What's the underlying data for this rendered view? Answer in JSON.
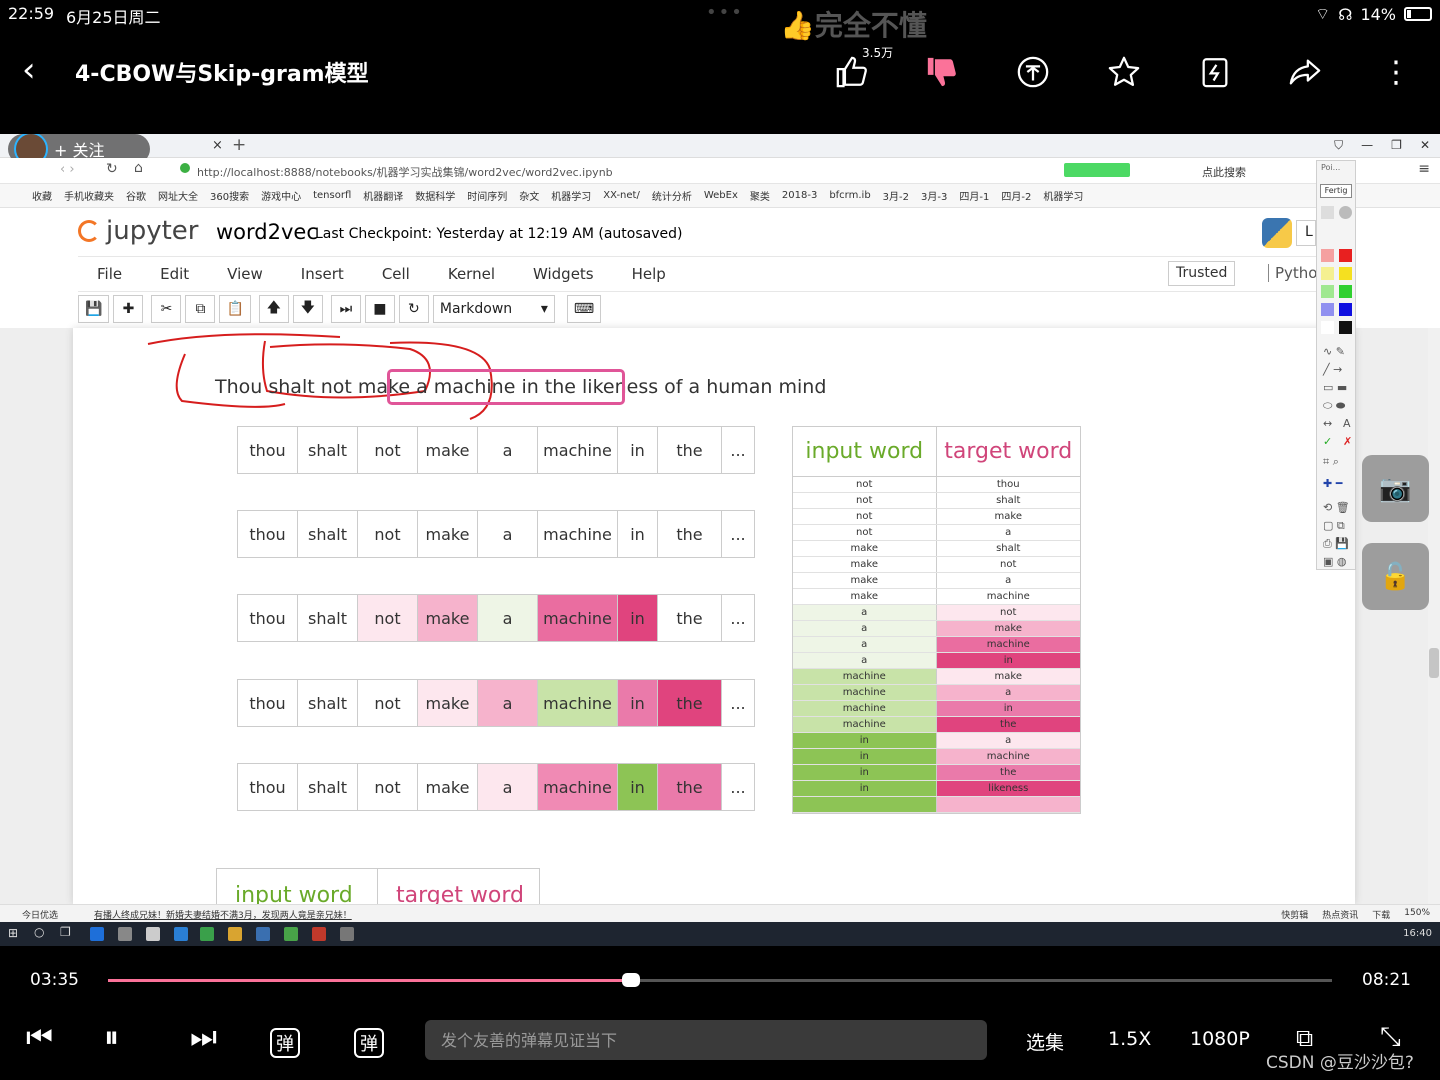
{
  "status_bar": {
    "time": "22:59",
    "date": "6月25日周二",
    "battery": "14%"
  },
  "overlay_text": "完全不懂",
  "header": {
    "title": "4-CBOW与Skip-gram模型",
    "like_count": "3.5万"
  },
  "browser": {
    "follow_label": "+ 关注",
    "url": "http://localhost:8888/notebooks/机器学习实战集锦/word2vec/word2vec.ipynb",
    "search_hint": "点此搜索",
    "bookmarks": [
      "收藏",
      "手机收藏夹",
      "谷歌",
      "网址大全",
      "360搜索",
      "游戏中心",
      "tensorfl",
      "机器翻译",
      "数据科学",
      "时间序列",
      "杂文",
      "机器学习",
      "XX-net/",
      "统计分析",
      "WebEx",
      "聚类",
      "2018-3",
      "bfcrm.ib",
      "3月-2",
      "3月-3",
      "四月-1",
      "四月-2",
      "机器学习"
    ]
  },
  "jupyter": {
    "logo": "jupyter",
    "notebook_name": "word2vec",
    "checkpoint": "Last Checkpoint: Yesterday at 12:19 AM (autosaved)",
    "kernel_box": "L",
    "menu": [
      "File",
      "Edit",
      "View",
      "Insert",
      "Cell",
      "Kernel",
      "Widgets",
      "Help"
    ],
    "trusted": "Trusted",
    "kernel_name": "Pythor",
    "cell_type": "Markdown"
  },
  "palette": {
    "title": "Poi...",
    "done": "Fertig",
    "text_tool": "A"
  },
  "notebook": {
    "sentence": "Thou shalt not make a machine in the likeness of a human mind",
    "rows": [
      {
        "cells": [
          "thou",
          "shalt",
          "not",
          "make",
          "a",
          "machine",
          "in",
          "the",
          "..."
        ],
        "colors": [
          "#fff",
          "#fff",
          "#fff",
          "#fff",
          "#fff",
          "#fff",
          "#fff",
          "#fff",
          "#fff"
        ]
      },
      {
        "cells": [
          "thou",
          "shalt",
          "not",
          "make",
          "a",
          "machine",
          "in",
          "the",
          "..."
        ],
        "colors": [
          "#fff",
          "#fff",
          "#fff",
          "#fff",
          "#fff",
          "#fff",
          "#fff",
          "#fff",
          "#fff"
        ]
      },
      {
        "cells": [
          "thou",
          "shalt",
          "not",
          "make",
          "a",
          "machine",
          "in",
          "the",
          "..."
        ],
        "colors": [
          "#fff",
          "#fff",
          "#fde7ee",
          "#f6b3cc",
          "#eef5e6",
          "#ea6da0",
          "#e0447e",
          "#fff",
          "#fff"
        ]
      },
      {
        "cells": [
          "thou",
          "shalt",
          "not",
          "make",
          "a",
          "machine",
          "in",
          "the",
          "..."
        ],
        "colors": [
          "#fff",
          "#fff",
          "#fff",
          "#fde7ee",
          "#f6b3cc",
          "#c8e3a8",
          "#ea7aaa",
          "#e0447e",
          "#fff"
        ]
      },
      {
        "cells": [
          "thou",
          "shalt",
          "not",
          "make",
          "a",
          "machine",
          "in",
          "the",
          "..."
        ],
        "colors": [
          "#fff",
          "#fff",
          "#fff",
          "#fff",
          "#fde7ee",
          "#f08ab4",
          "#8dc455",
          "#ea7aaa",
          "#fff"
        ]
      }
    ],
    "pair_table": {
      "headers": [
        "input word",
        "target word"
      ],
      "rows": [
        {
          "input": "not",
          "target": "thou",
          "ic": "#fff",
          "tc": "#fff"
        },
        {
          "input": "not",
          "target": "shalt",
          "ic": "#fff",
          "tc": "#fff"
        },
        {
          "input": "not",
          "target": "make",
          "ic": "#fff",
          "tc": "#fff"
        },
        {
          "input": "not",
          "target": "a",
          "ic": "#fff",
          "tc": "#fff"
        },
        {
          "input": "make",
          "target": "shalt",
          "ic": "#fff",
          "tc": "#fff"
        },
        {
          "input": "make",
          "target": "not",
          "ic": "#fff",
          "tc": "#fff"
        },
        {
          "input": "make",
          "target": "a",
          "ic": "#fff",
          "tc": "#fff"
        },
        {
          "input": "make",
          "target": "machine",
          "ic": "#fff",
          "tc": "#fff"
        },
        {
          "input": "a",
          "target": "not",
          "ic": "#eef5e6",
          "tc": "#fde7ee"
        },
        {
          "input": "a",
          "target": "make",
          "ic": "#eef5e6",
          "tc": "#f6b3cc"
        },
        {
          "input": "a",
          "target": "machine",
          "ic": "#eef5e6",
          "tc": "#ea6da0"
        },
        {
          "input": "a",
          "target": "in",
          "ic": "#eef5e6",
          "tc": "#e0447e"
        },
        {
          "input": "machine",
          "target": "make",
          "ic": "#c8e3a8",
          "tc": "#fde7ee"
        },
        {
          "input": "machine",
          "target": "a",
          "ic": "#c8e3a8",
          "tc": "#f6b3cc"
        },
        {
          "input": "machine",
          "target": "in",
          "ic": "#c8e3a8",
          "tc": "#ea7aaa"
        },
        {
          "input": "machine",
          "target": "the",
          "ic": "#c8e3a8",
          "tc": "#e0447e"
        },
        {
          "input": "in",
          "target": "a",
          "ic": "#8dc455",
          "tc": "#fde7ee"
        },
        {
          "input": "in",
          "target": "machine",
          "ic": "#8dc455",
          "tc": "#f6b3cc"
        },
        {
          "input": "in",
          "target": "the",
          "ic": "#8dc455",
          "tc": "#ea7aaa"
        },
        {
          "input": "in",
          "target": "likeness",
          "ic": "#8dc455",
          "tc": "#e0447e"
        },
        {
          "input": "",
          "target": "",
          "ic": "#8dc455",
          "tc": "#f6b3cc"
        }
      ]
    },
    "bottom_headers": [
      "input word",
      "target word"
    ]
  },
  "browser_status": {
    "left1": "今日优选",
    "left2": "有播人终成兄妹！新婚夫妻结婚不满3月，发现两人竟是亲兄妹！",
    "right": [
      "快剪辑",
      "热点资讯",
      "下载",
      "150%"
    ]
  },
  "taskbar": {
    "clock": "16:40"
  },
  "player": {
    "current": "03:35",
    "duration": "08:21",
    "progress": 0.427,
    "danmu_placeholder": "发个友善的弹幕见证当下",
    "episodes": "选集",
    "speed": "1.5X",
    "quality": "1080P",
    "danmu_on": "弹",
    "danmu_settings": "弹",
    "watermark": "CSDN @豆沙沙包?"
  },
  "colors": {
    "accent": "#fb7299",
    "jupyter_orange": "#f37626",
    "green": "#8dc455",
    "pink": "#e0447e"
  }
}
